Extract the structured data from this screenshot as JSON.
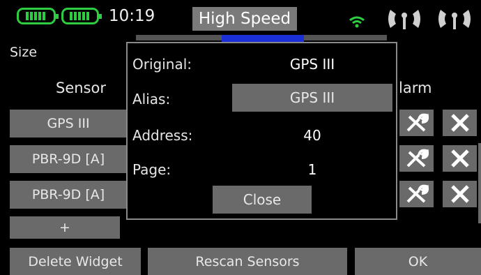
{
  "status_bar": {
    "time": "10:19",
    "mode_label": "High Speed",
    "battery_icons": [
      "battery-icon",
      "battery-icon"
    ],
    "signal_icons": [
      "wifi-icon",
      "antenna-icon",
      "antenna-icon"
    ]
  },
  "screen": {
    "title": "Size",
    "column_sensor": "Sensor",
    "column_alarm": "larm"
  },
  "sensors": [
    {
      "label": "GPS III"
    },
    {
      "label": "PBR-9D [A]"
    },
    {
      "label": "PBR-9D [A]"
    }
  ],
  "add_label": "+",
  "row_icons": [
    "wrench-icon",
    "close-icon"
  ],
  "dialog": {
    "original_label": "Original:",
    "original_value": "GPS III",
    "alias_label": "Alias:",
    "alias_value": "GPS III",
    "address_label": "Address:",
    "address_value": "40",
    "page_label": "Page:",
    "page_value": "1",
    "close_label": "Close"
  },
  "footer": {
    "delete_label": "Delete Widget",
    "rescan_label": "Rescan Sensors",
    "ok_label": "OK"
  },
  "colors": {
    "accent_green": "#2ecc40",
    "button_gray": "#6a6a6a",
    "tab_blue": "#1a2fd6"
  }
}
